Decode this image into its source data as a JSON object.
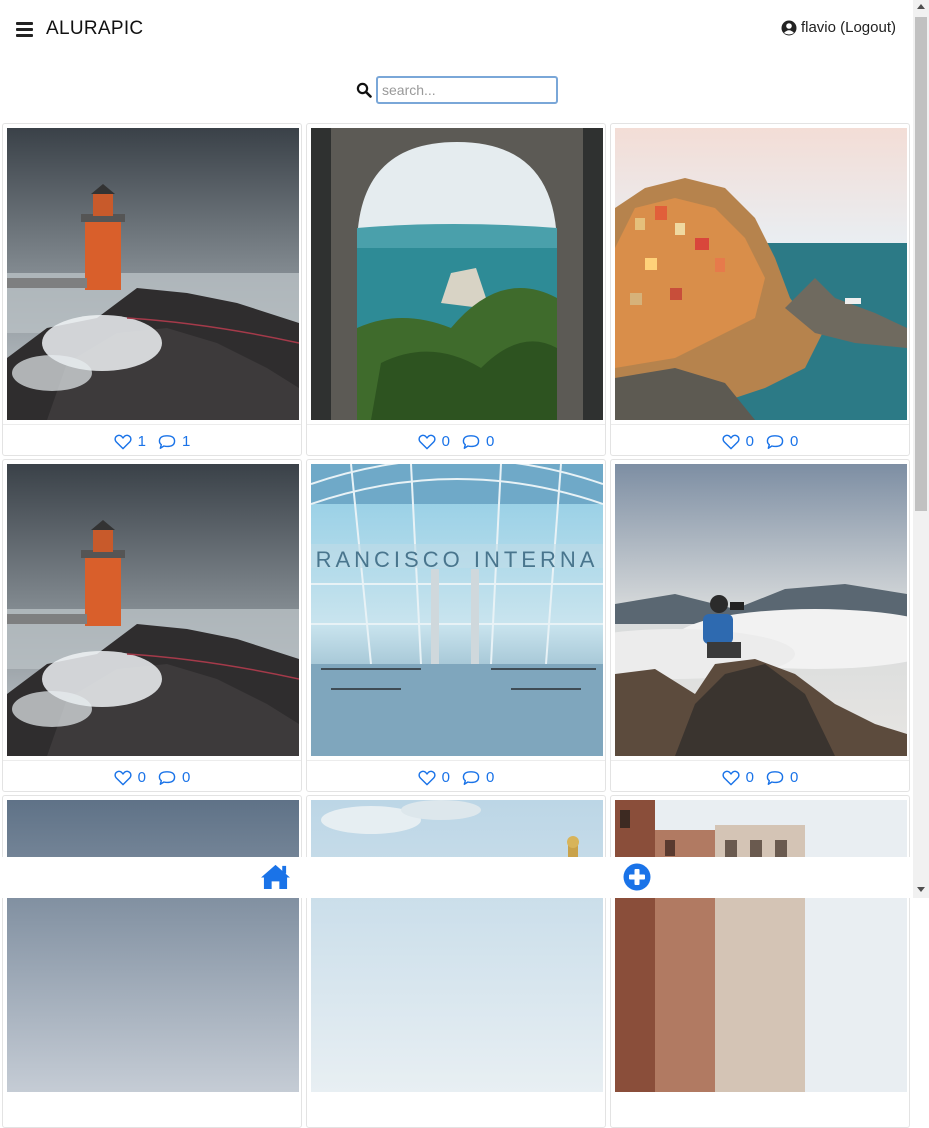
{
  "header": {
    "menu_icon": "hamburger-icon",
    "brand": "ALURAPIC",
    "user_icon": "user-circle-icon",
    "user_text": "flavio (Logout)"
  },
  "search": {
    "icon": "search-icon",
    "placeholder": "search..."
  },
  "photos": [
    {
      "scene": "lighthouse",
      "likes": "1",
      "comments": "1"
    },
    {
      "scene": "arch-sea",
      "likes": "0",
      "comments": "0"
    },
    {
      "scene": "cliff-village",
      "likes": "0",
      "comments": "0"
    },
    {
      "scene": "lighthouse",
      "likes": "0",
      "comments": "0"
    },
    {
      "scene": "airport",
      "likes": "0",
      "comments": "0"
    },
    {
      "scene": "photographer",
      "likes": "0",
      "comments": "0"
    },
    {
      "scene": "sky"
    },
    {
      "scene": "sky-statue"
    },
    {
      "scene": "buildings"
    }
  ],
  "airport_sign": "RANCISCO INTERNA",
  "footer": {
    "home_icon": "home-icon",
    "add_icon": "plus-circle-icon"
  },
  "colors": {
    "accent": "#1a73e8",
    "search_border": "#7aa7d8"
  }
}
